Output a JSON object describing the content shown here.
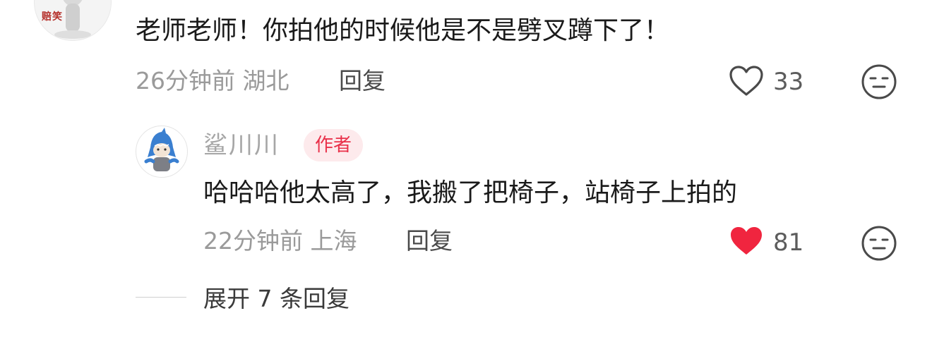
{
  "comment": {
    "avatar_tag": "赔笑",
    "text": "老师老师！你拍他的时候他是不是劈叉蹲下了！",
    "time": "26分钟前",
    "location": "湖北",
    "reply_label": "回复",
    "likes": "33",
    "liked": false,
    "like_icon": "heart-outline-icon",
    "dislike_icon": "meh-face-icon"
  },
  "reply": {
    "author": "鲨川川",
    "badge": "作者",
    "text": "哈哈哈他太高了，我搬了把椅子，站椅子上拍的",
    "time": "22分钟前",
    "location": "上海",
    "reply_label": "回复",
    "likes": "81",
    "liked": true,
    "like_icon": "heart-filled-icon",
    "dislike_icon": "meh-face-icon"
  },
  "expand": {
    "label": "展开 7 条回复"
  },
  "colors": {
    "liked_red": "#f0253f",
    "badge_bg": "#fdeaec",
    "badge_text": "#e9314a",
    "meta_gray": "#9a9a9a"
  }
}
